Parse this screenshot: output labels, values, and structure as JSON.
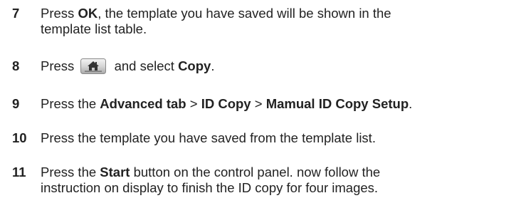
{
  "steps": [
    {
      "number": "7",
      "p1": "Press ",
      "b1": "OK",
      "p2": ", the template you have saved will be shown in the",
      "line2": "template list table."
    },
    {
      "number": "8",
      "p1": "Press",
      "home_icon": "home-icon",
      "p2": "and select ",
      "b1": "Copy",
      "p3": "."
    },
    {
      "number": "9",
      "p1": "Press the ",
      "b1": "Advanced tab",
      "p2": " > ",
      "b2": "ID Copy",
      "p3": " > ",
      "b3": "Mamual ID Copy Setup",
      "p4": "."
    },
    {
      "number": "10",
      "p1": "Press the template you have saved from the template list."
    },
    {
      "number": "11",
      "p1": "Press the ",
      "b1": "Start",
      "p2": " button on the control panel. now follow the",
      "line2": "instruction on display to finish the ID copy for four images."
    }
  ]
}
